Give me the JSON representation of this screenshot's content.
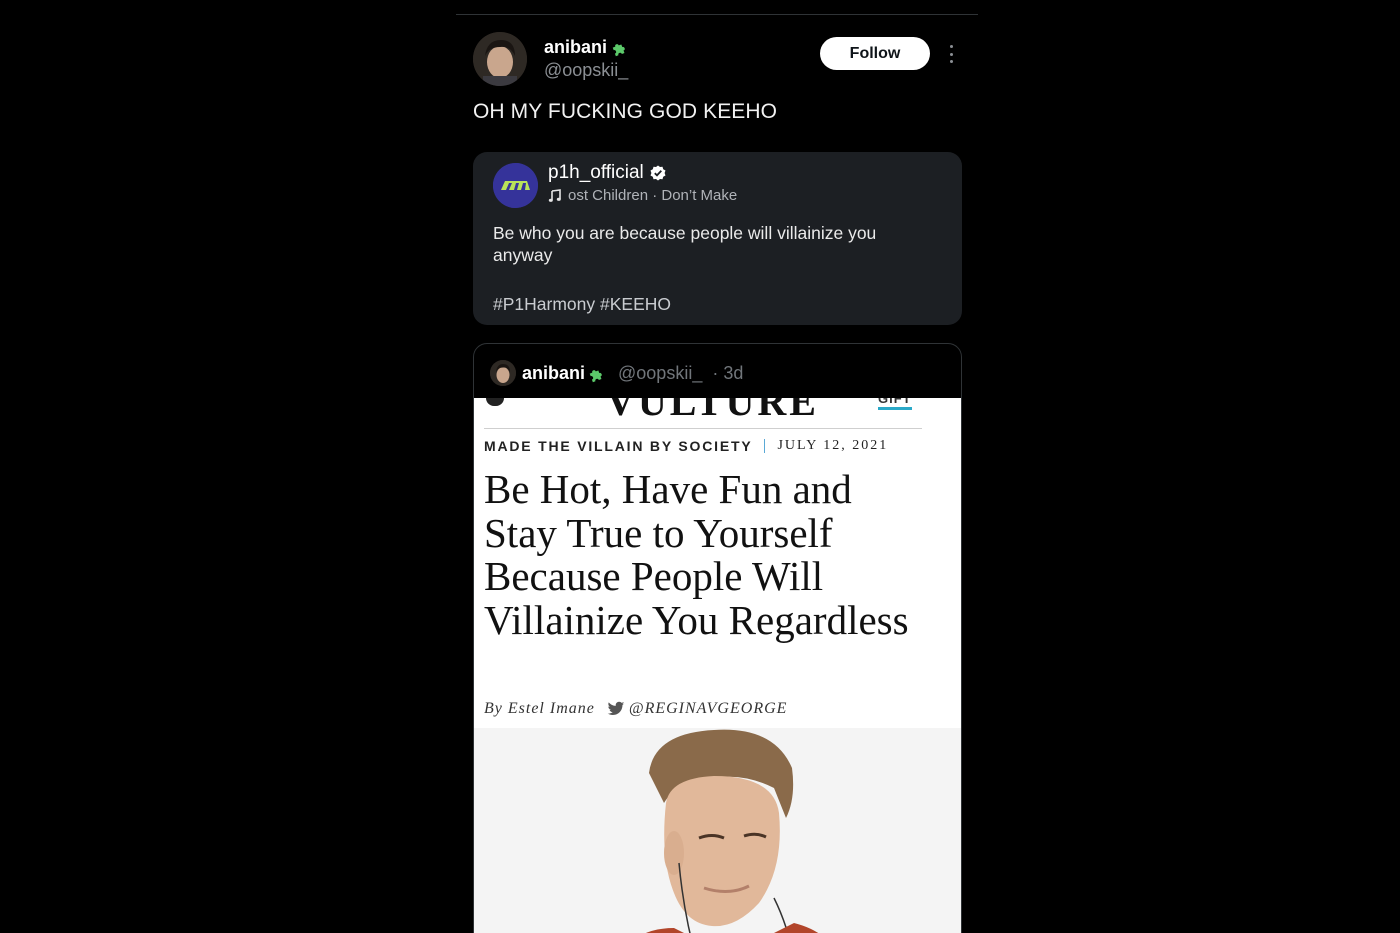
{
  "post": {
    "author_name": "anibani",
    "author_handle": "@oopskii_",
    "follow_label": "Follow",
    "text": "OH MY FUCKING GOD KEEHO"
  },
  "quoted": {
    "name": "p1h_official",
    "music": "ost Children · Don’t Make",
    "body": "Be who you are because people will villainize you anyway",
    "tags": "#P1Harmony #KEEHO"
  },
  "embedded": {
    "author_name": "anibani",
    "author_handle": "@oopskii_",
    "age": "· 3d",
    "article": {
      "publication": "VULTURE",
      "gift_label": "GIFT",
      "kicker": "MADE THE VILLAIN BY SOCIETY",
      "date": "JULY 12, 2021",
      "headline": "Be Hot, Have Fun and Stay True to Yourself Because People Will Villainize You Regardless",
      "byline": "By Estel Imane",
      "byline_twitter": "@REGINAVGEORGE"
    }
  },
  "colors": {
    "background": "#000000",
    "card": "#1c1f23",
    "muted": "#8b8f94",
    "puzzle_green": "#4caf50",
    "verified": "#ffffff"
  },
  "icons": [
    "puzzle-icon",
    "more-icon",
    "verified-icon",
    "music-icon",
    "twitter-icon"
  ]
}
